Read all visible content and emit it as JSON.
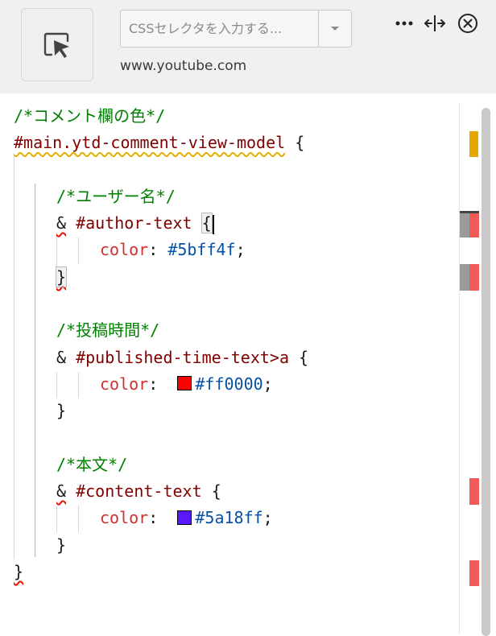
{
  "header": {
    "picker_icon": "element-picker-icon",
    "selector_placeholder": "CSSセレクタを入力する...",
    "selector_value": "",
    "dropdown_icon": "chevron-down-icon",
    "hostname": "www.youtube.com",
    "more_icon": "more-horizontal-icon",
    "resize_icon": "resize-horizontal-icon",
    "close_icon": "close-icon"
  },
  "editor": {
    "lines": {
      "l1_comment": "/*コメント欄の色*/",
      "l2_selector": "#main.ytd-comment-view-model",
      "l2_brace": "{",
      "l4_comment": "/*ユーザー名*/",
      "l5_amp": "&",
      "l5_selector": "#author-text",
      "l5_brace": "{",
      "l6_prop": "color",
      "l6_colon": ":",
      "l6_value": "#5bff4f",
      "l6_semi": ";",
      "l7_close": "}",
      "l9_comment": "/*投稿時間*/",
      "l10_amp": "&",
      "l10_selector": "#published-time-text>a",
      "l10_brace": "{",
      "l11_prop": "color",
      "l11_colon": ":",
      "l11_value": "#ff0000",
      "l11_semi": ";",
      "l12_close": "}",
      "l14_comment": "/*本文*/",
      "l15_amp": "&",
      "l15_selector": "#content-text",
      "l15_brace": "{",
      "l16_prop": "color",
      "l16_colon": ":",
      "l16_value": "#5a18ff",
      "l16_semi": ";",
      "l17_close": "}",
      "l18_close": "}"
    },
    "swatch_colors": {
      "published_time": "#ff0000",
      "content_text": "#5a18ff"
    }
  },
  "colors": {
    "comment": "#008000",
    "selector": "#800000",
    "property": "#cd3131",
    "value": "#0451a5",
    "warning_marker": "#e6a800",
    "error_marker": "#f25a5a"
  }
}
